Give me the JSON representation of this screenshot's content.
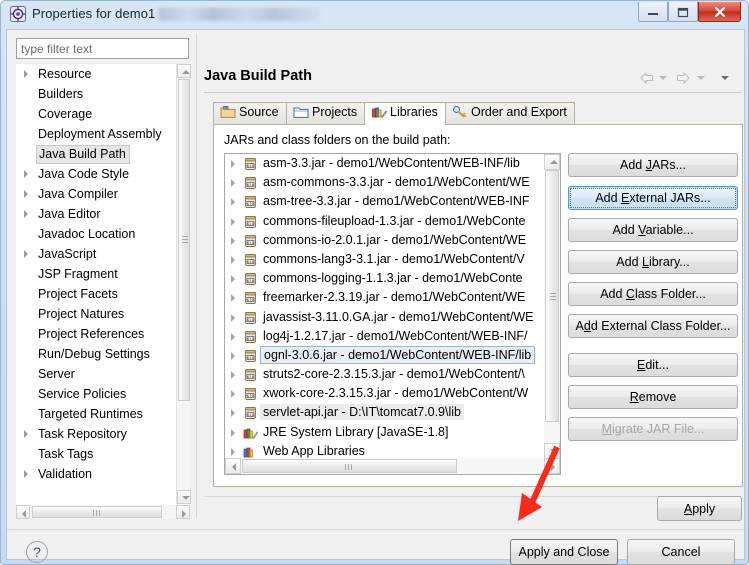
{
  "window": {
    "title": "Properties for demo1",
    "icon": "properties-icon",
    "controls": [
      {
        "name": "minimize",
        "glyph": "–"
      },
      {
        "name": "restore",
        "glyph": "□"
      },
      {
        "name": "close",
        "glyph": "✕"
      }
    ]
  },
  "sidebar": {
    "filter": {
      "placeholder": "type filter text",
      "value": ""
    },
    "items": [
      {
        "label": "Resource",
        "expandable": true,
        "selected": false
      },
      {
        "label": "Builders",
        "expandable": false,
        "selected": false
      },
      {
        "label": "Coverage",
        "expandable": false,
        "selected": false
      },
      {
        "label": "Deployment Assembly",
        "expandable": false,
        "selected": false
      },
      {
        "label": "Java Build Path",
        "expandable": false,
        "selected": true
      },
      {
        "label": "Java Code Style",
        "expandable": true,
        "selected": false
      },
      {
        "label": "Java Compiler",
        "expandable": true,
        "selected": false
      },
      {
        "label": "Java Editor",
        "expandable": true,
        "selected": false
      },
      {
        "label": "Javadoc Location",
        "expandable": false,
        "selected": false
      },
      {
        "label": "JavaScript",
        "expandable": true,
        "selected": false
      },
      {
        "label": "JSP Fragment",
        "expandable": false,
        "selected": false
      },
      {
        "label": "Project Facets",
        "expandable": false,
        "selected": false
      },
      {
        "label": "Project Natures",
        "expandable": false,
        "selected": false
      },
      {
        "label": "Project References",
        "expandable": false,
        "selected": false
      },
      {
        "label": "Run/Debug Settings",
        "expandable": false,
        "selected": false
      },
      {
        "label": "Server",
        "expandable": false,
        "selected": false
      },
      {
        "label": "Service Policies",
        "expandable": false,
        "selected": false
      },
      {
        "label": "Targeted Runtimes",
        "expandable": false,
        "selected": false
      },
      {
        "label": "Task Repository",
        "expandable": true,
        "selected": false
      },
      {
        "label": "Task Tags",
        "expandable": false,
        "selected": false
      },
      {
        "label": "Validation",
        "expandable": true,
        "selected": false
      }
    ]
  },
  "page": {
    "title": "Java Build Path",
    "nav": {
      "back_icon": "back-arrow-icon",
      "back_menu_icon": "chevron-down-icon",
      "forward_icon": "forward-arrow-icon",
      "forward_menu_icon": "chevron-down-icon",
      "view_menu_icon": "chevron-down-icon"
    },
    "tabs": [
      {
        "label": "Source",
        "icon": "source-folder-icon",
        "active": false
      },
      {
        "label": "Projects",
        "icon": "projects-folder-icon",
        "active": false
      },
      {
        "label": "Libraries",
        "icon": "libraries-books-icon",
        "active": true
      },
      {
        "label": "Order and Export",
        "icon": "order-export-icon",
        "active": false
      }
    ],
    "panel_caption": "JARs and class folders on the build path:",
    "jars": [
      {
        "label": "asm-3.3.jar - demo1/WebContent/WEB-INF/lib",
        "icon": "jar-icon",
        "state": "normal"
      },
      {
        "label": "asm-commons-3.3.jar - demo1/WebContent/WE",
        "icon": "jar-icon",
        "state": "normal"
      },
      {
        "label": "asm-tree-3.3.jar - demo1/WebContent/WEB-INF",
        "icon": "jar-icon",
        "state": "normal"
      },
      {
        "label": "commons-fileupload-1.3.jar - demo1/WebConte",
        "icon": "jar-icon",
        "state": "normal"
      },
      {
        "label": "commons-io-2.0.1.jar - demo1/WebContent/WE",
        "icon": "jar-icon",
        "state": "normal"
      },
      {
        "label": "commons-lang3-3.1.jar - demo1/WebContent/V",
        "icon": "jar-icon",
        "state": "normal"
      },
      {
        "label": "commons-logging-1.1.3.jar - demo1/WebConte",
        "icon": "jar-icon",
        "state": "normal"
      },
      {
        "label": "freemarker-2.3.19.jar - demo1/WebContent/WE",
        "icon": "jar-icon",
        "state": "normal"
      },
      {
        "label": "javassist-3.11.0.GA.jar - demo1/WebContent/WE",
        "icon": "jar-icon",
        "state": "normal"
      },
      {
        "label": "log4j-1.2.17.jar - demo1/WebContent/WEB-INF/",
        "icon": "jar-icon",
        "state": "normal"
      },
      {
        "label": "ognl-3.0.6.jar - demo1/WebContent/WEB-INF/lib",
        "icon": "jar-icon",
        "state": "selected"
      },
      {
        "label": "struts2-core-2.3.15.3.jar - demo1/WebContent/\\",
        "icon": "jar-icon",
        "state": "normal"
      },
      {
        "label": "xwork-core-2.3.15.3.jar - demo1/WebContent/W",
        "icon": "jar-icon",
        "state": "normal"
      },
      {
        "label": "servlet-api.jar - D:\\IT\\tomcat7.0.9\\lib",
        "icon": "jar-icon",
        "state": "highlight"
      },
      {
        "label": "JRE System Library [JavaSE-1.8]",
        "icon": "jre-library-icon",
        "state": "normal"
      },
      {
        "label": "Web App Libraries",
        "icon": "web-library-icon",
        "state": "normal"
      }
    ],
    "side_buttons": [
      {
        "label": "Add JARs...",
        "mnemonic": "J",
        "state": "normal"
      },
      {
        "label": "Add External JARs...",
        "mnemonic": "E",
        "state": "focused"
      },
      {
        "label": "Add Variable...",
        "mnemonic": "V",
        "state": "normal"
      },
      {
        "label": "Add Library...",
        "mnemonic": "L",
        "state": "normal"
      },
      {
        "label": "Add Class Folder...",
        "mnemonic": "C",
        "state": "normal"
      },
      {
        "label": "Add External Class Folder...",
        "mnemonic": "d",
        "state": "normal"
      },
      {
        "label": "Edit...",
        "mnemonic": "E",
        "state": "normal"
      },
      {
        "label": "Remove",
        "mnemonic": "R",
        "state": "normal"
      },
      {
        "label": "Migrate JAR File...",
        "mnemonic": "M",
        "state": "disabled"
      }
    ],
    "apply_label": "Apply",
    "apply_mnemonic": "A"
  },
  "footer": {
    "help_icon": "help-question-icon",
    "apply_and_close_label": "Apply and Close",
    "cancel_label": "Cancel"
  },
  "annotation": {
    "arrow_color": "#fc2a18",
    "points_to": "Apply and Close"
  },
  "colors": {
    "window_chrome": "#cfe0f2",
    "client_bg": "#f0f0f0",
    "selection_blue": "#e8eef5",
    "close_red": "#d64533"
  }
}
